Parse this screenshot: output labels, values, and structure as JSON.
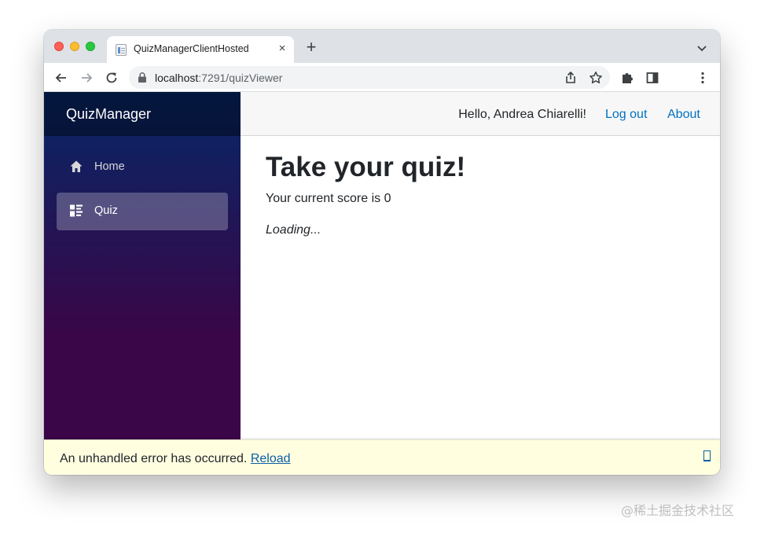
{
  "browser": {
    "tab_title": "QuizManagerClientHosted",
    "tab_close": "×",
    "new_tab": "+",
    "url_host": "localhost",
    "url_path": ":7291/quizViewer"
  },
  "app": {
    "brand": "QuizManager",
    "nav": [
      {
        "label": "Home",
        "icon": "home-icon",
        "active": false
      },
      {
        "label": "Quiz",
        "icon": "list-icon",
        "active": true
      }
    ],
    "topbar": {
      "greeting": "Hello, Andrea Chiarelli!",
      "logout": "Log out",
      "about": "About"
    }
  },
  "main": {
    "title": "Take your quiz!",
    "score": "Your current score is 0",
    "loading": "Loading..."
  },
  "error": {
    "message": "An unhandled error has occurred.",
    "reload": "Reload",
    "dismiss_icon": "dismiss-icon"
  },
  "watermark": "@稀土掘金技术社区",
  "colors": {
    "sidebar_top": "#052767",
    "sidebar_bottom": "#3a0647",
    "link": "#0071c1",
    "error_bg": "#ffffe0"
  }
}
